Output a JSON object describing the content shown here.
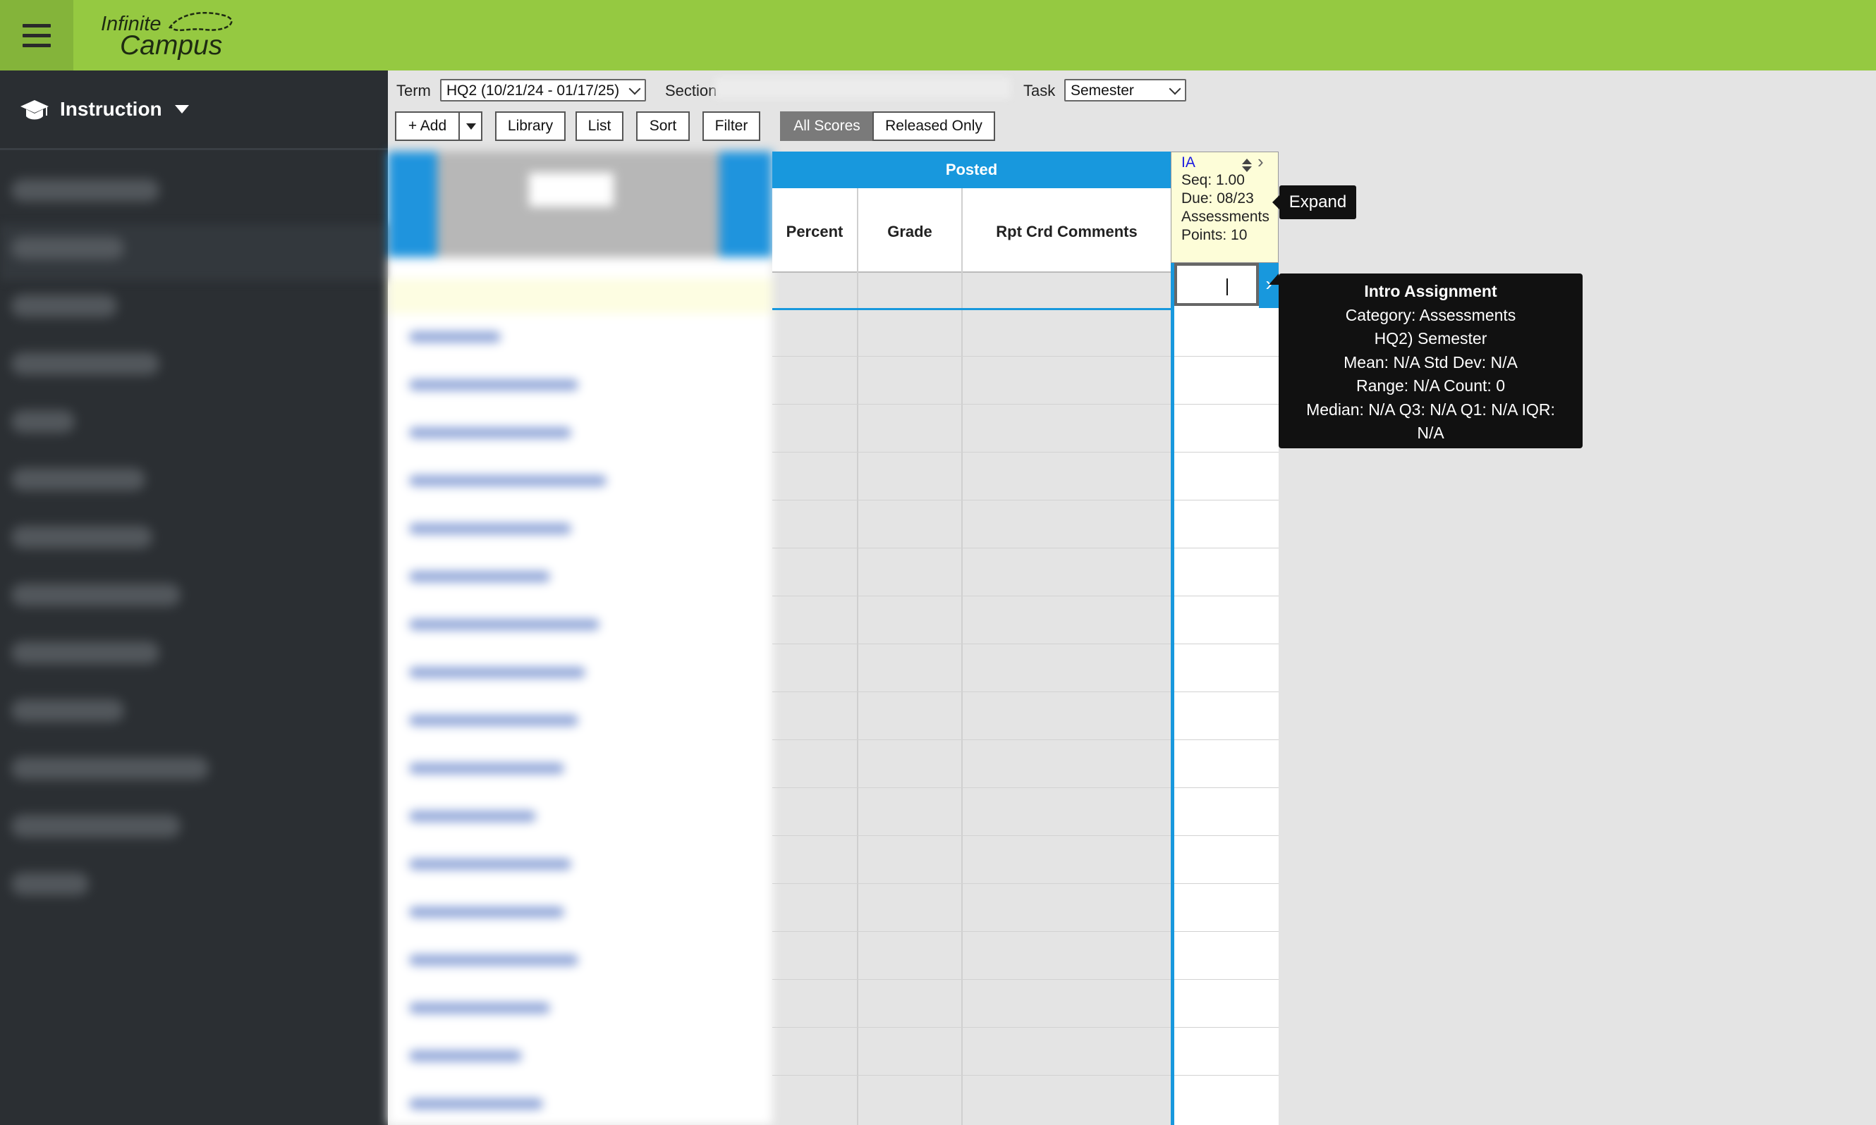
{
  "app": {
    "logo_line1": "Infinite",
    "logo_line2": "Campus"
  },
  "sidebar": {
    "module_label": "Instruction"
  },
  "filters": {
    "term_label": "Term",
    "term_value": "HQ2 (10/21/24 - 01/17/25)",
    "section_label": "Section",
    "task_label": "Task",
    "task_value": "Semester"
  },
  "toolbar": {
    "add_label": "+ Add",
    "library_label": "Library",
    "list_label": "List",
    "sort_label": "Sort",
    "filter_label": "Filter",
    "all_scores_label": "All Scores",
    "released_only_label": "Released Only"
  },
  "grid": {
    "posted_header": "Posted",
    "columns": [
      "Percent",
      "Grade",
      "Rpt Crd Comments"
    ]
  },
  "assignment": {
    "code": "IA",
    "seq": "Seq: 1.00",
    "due": "Due: 08/23",
    "category": "Assessments",
    "points": "Points: 10",
    "expand_tooltip": "Expand"
  },
  "tooltip": {
    "title": "Intro Assignment",
    "lines": [
      "Category: Assessments",
      "HQ2) Semester",
      "Mean: N/A Std Dev: N/A",
      "Range: N/A Count: 0",
      "Median: N/A Q3: N/A Q1: N/A IQR:",
      "N/A"
    ]
  },
  "colors": {
    "topbar": "#95c941",
    "sidebar": "#2b2f33",
    "accent_blue": "#1898dd",
    "assignment_head": "#fdfdd8"
  }
}
